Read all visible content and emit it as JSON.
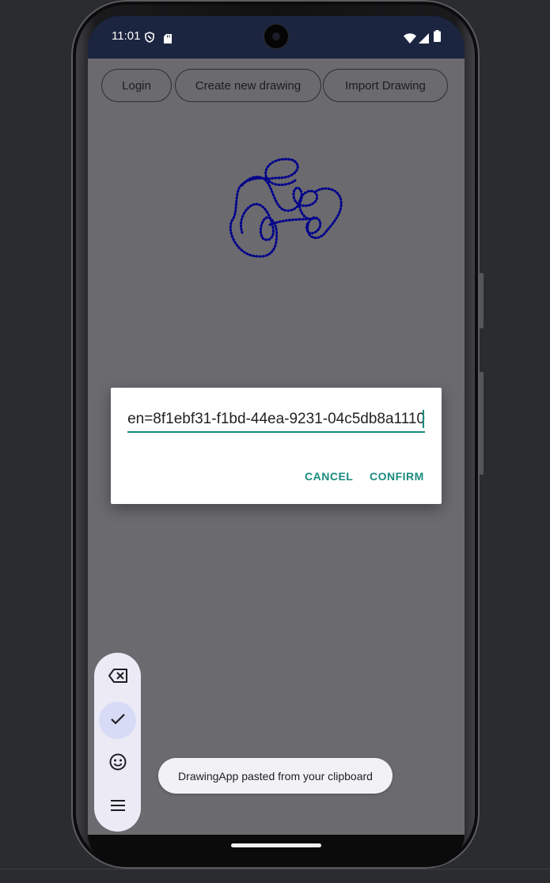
{
  "status_bar": {
    "time": "11:01",
    "icons": [
      "shield-icon",
      "sd-card-icon",
      "wifi-icon",
      "signal-icon",
      "battery-icon"
    ]
  },
  "top_buttons": {
    "login": "Login",
    "create": "Create new drawing",
    "import": "Import Drawing"
  },
  "dialog": {
    "input_value": "en=8f1ebf31-f1bd-44ea-9231-04c5db8a1110",
    "cancel": "CANCEL",
    "confirm": "CONFIRM"
  },
  "toolbar": {
    "items": [
      "backspace-icon",
      "check-icon",
      "emoji-icon",
      "menu-icon"
    ],
    "active": "check-icon"
  },
  "toast": {
    "text": "DrawingApp pasted from your clipboard"
  },
  "colors": {
    "accent": "#1a8a7e",
    "stroke": "#00008b",
    "app_background": "#6b6a6f",
    "status_bar": "#1c2540"
  }
}
